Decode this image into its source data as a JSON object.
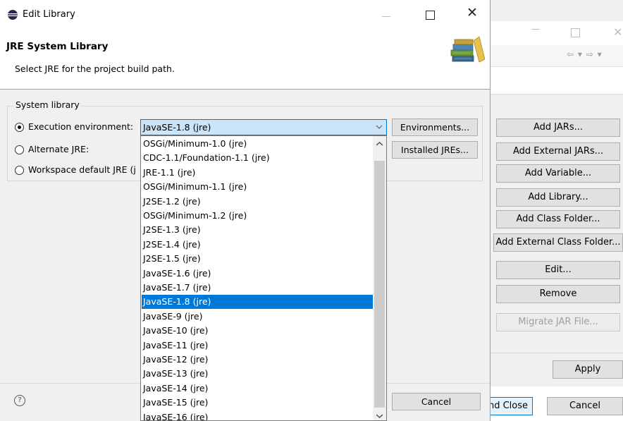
{
  "background_window": {
    "buttons": [
      "Add JARs...",
      "Add External JARs...",
      "Add Variable...",
      "Add Library...",
      "Add Class Folder...",
      "Add External Class Folder...",
      "Edit...",
      "Remove",
      "Migrate JAR File..."
    ],
    "apply_label": "Apply",
    "apply_close_label": "nd Close",
    "cancel_label": "Cancel"
  },
  "dialog": {
    "title": "Edit Library",
    "header_title": "JRE System Library",
    "header_description": "Select JRE for the project build path.",
    "group_label": "System library",
    "radio_execution_env": "Execution environment:",
    "radio_alternate_jre": "Alternate JRE:",
    "radio_workspace_default": "Workspace default JRE (j",
    "combo_value": "JavaSE-1.8 (jre)",
    "environments_button": "Environments...",
    "installed_jres_button": "Installed JREs...",
    "cancel_button": "Cancel",
    "help_icon_glyph": "?"
  },
  "dropdown_items": [
    "OSGi/Minimum-1.0 (jre)",
    "CDC-1.1/Foundation-1.1 (jre)",
    "JRE-1.1 (jre)",
    "OSGi/Minimum-1.1 (jre)",
    "J2SE-1.2 (jre)",
    "OSGi/Minimum-1.2 (jre)",
    "J2SE-1.3 (jre)",
    "J2SE-1.4 (jre)",
    "J2SE-1.5 (jre)",
    "JavaSE-1.6 (jre)",
    "JavaSE-1.7 (jre)",
    "JavaSE-1.8 (jre)",
    "JavaSE-9 (jre)",
    "JavaSE-10 (jre)",
    "JavaSE-11 (jre)",
    "JavaSE-12 (jre)",
    "JavaSE-13 (jre)",
    "JavaSE-14 (jre)",
    "JavaSE-15 (jre)",
    "JavaSE-16 (jre)"
  ],
  "selected_item": "JavaSE-1.8 (jre)",
  "icons": {
    "app": "eclipse-icon",
    "header": "library-books-icon",
    "help": "help-icon",
    "combo_arrow": "chevron-down-icon"
  },
  "colors": {
    "selection": "#0078d7",
    "combo_focus": "#cce4f7",
    "dialog_bg": "#f0f0f0"
  }
}
